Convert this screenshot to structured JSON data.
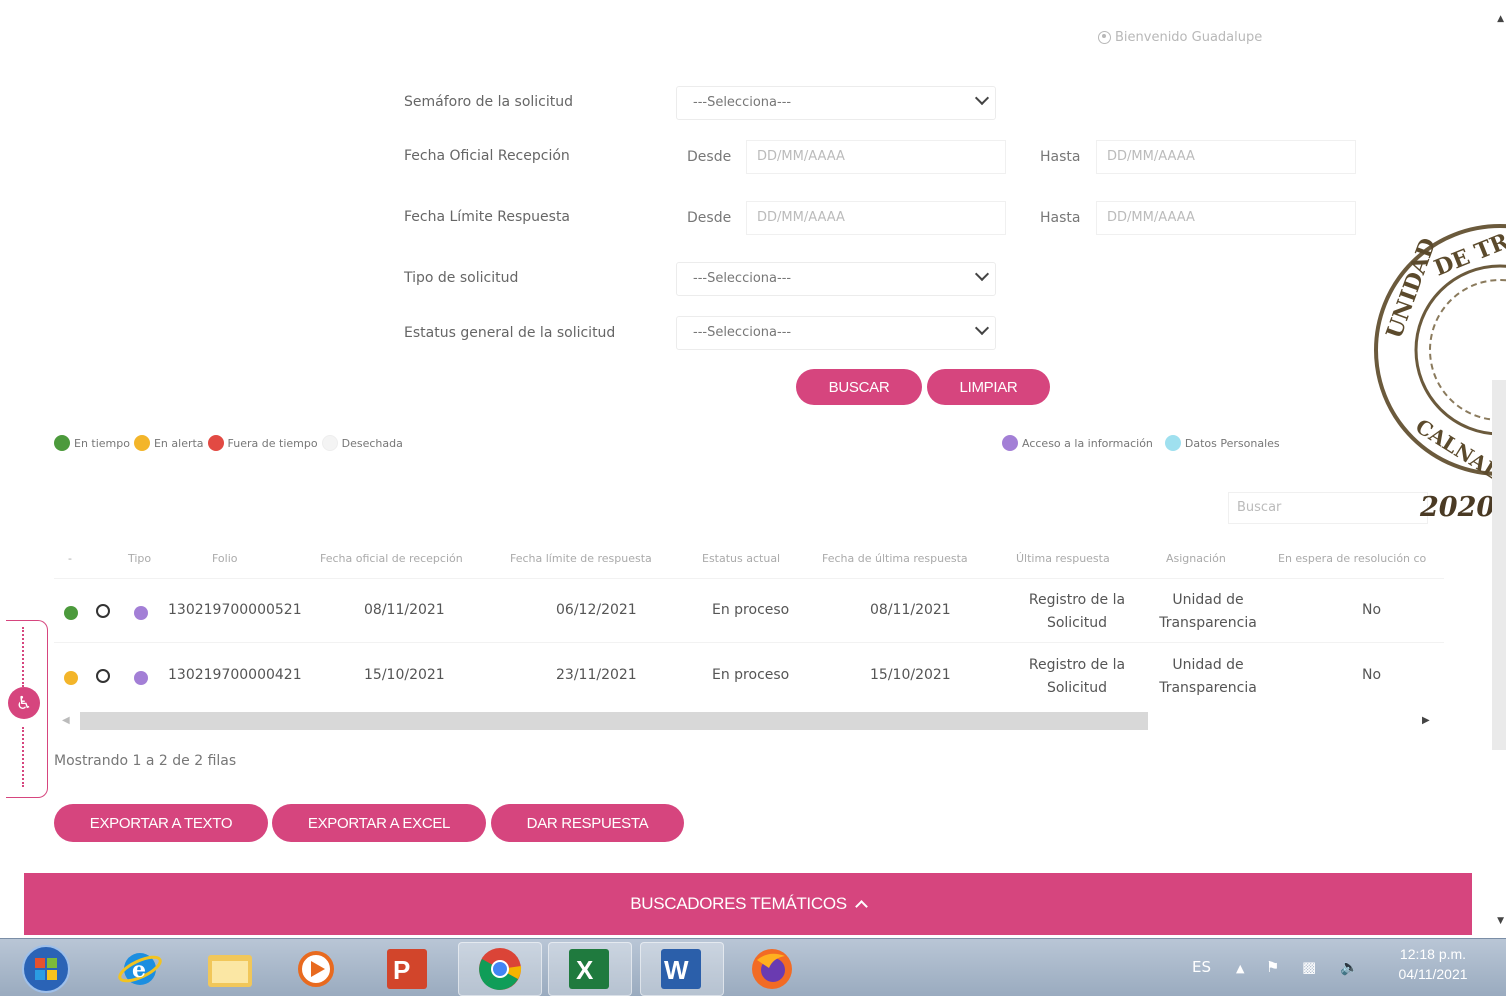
{
  "header": {
    "welcome": "Bienvenido Guadalupe"
  },
  "filters": {
    "semaforo_label": "Semáforo de la solicitud",
    "semaforo_value": "---Selecciona---",
    "fecha_recepcion_label": "Fecha Oficial Recepción",
    "fecha_limite_label": "Fecha Límite Respuesta",
    "desde": "Desde",
    "hasta": "Hasta",
    "date_placeholder": "DD/MM/AAAA",
    "tipo_label": "Tipo de solicitud",
    "tipo_value": "---Selecciona---",
    "estatus_label": "Estatus general de la solicitud",
    "estatus_value": "---Selecciona---",
    "buscar": "BUSCAR",
    "limpiar": "LIMPIAR"
  },
  "legend": {
    "en_tiempo": "En tiempo",
    "en_alerta": "En alerta",
    "fuera_tiempo": "Fuera de tiempo",
    "desechada": "Desechada",
    "acceso": "Acceso a la información",
    "datos": "Datos Personales"
  },
  "colors": {
    "accent": "#d6457e",
    "green": "#4c9a3c",
    "yellow": "#f3b52a",
    "red": "#e24a43",
    "purple": "#a37fd6",
    "cyan": "#9fe0ef"
  },
  "table": {
    "search_placeholder": "Buscar",
    "headers": {
      "blank": "-",
      "tipo": "Tipo",
      "folio": "Folio",
      "fecha_recepcion": "Fecha oficial de recepción",
      "fecha_limite": "Fecha límite de respuesta",
      "estatus": "Estatus actual",
      "fecha_ultima": "Fecha de última respuesta",
      "ultima": "Última respuesta",
      "asignacion": "Asignación",
      "espera": "En espera de resolución co"
    },
    "rows": [
      {
        "folio": "130219700000521",
        "fecha_recepcion": "08/11/2021",
        "fecha_limite": "06/12/2021",
        "estatus": "En proceso",
        "fecha_ultima": "08/11/2021",
        "ultima_l1": "Registro de la",
        "ultima_l2": "Solicitud",
        "asig_l1": "Unidad de",
        "asig_l2": "Transparencia",
        "espera": "No"
      },
      {
        "folio": "130219700000421",
        "fecha_recepcion": "15/10/2021",
        "fecha_limite": "23/11/2021",
        "estatus": "En proceso",
        "fecha_ultima": "15/10/2021",
        "ultima_l1": "Registro de la",
        "ultima_l2": "Solicitud",
        "asig_l1": "Unidad de",
        "asig_l2": "Transparencia",
        "espera": "No"
      }
    ],
    "showing": "Mostrando 1 a 2 de 2 filas"
  },
  "actions": {
    "exportar_texto": "EXPORTAR A TEXTO",
    "exportar_excel": "EXPORTAR A EXCEL",
    "dar_respuesta": "DAR RESPUESTA"
  },
  "footer": {
    "buscadores": "BUSCADORES TEMÁTICOS"
  },
  "seal": {
    "line1": "UNIDAD DE TR",
    "line2": "CALNAL",
    "year": "2020"
  },
  "taskbar": {
    "lang": "ES",
    "time": "12:18 p.m.",
    "date": "04/11/2021"
  }
}
